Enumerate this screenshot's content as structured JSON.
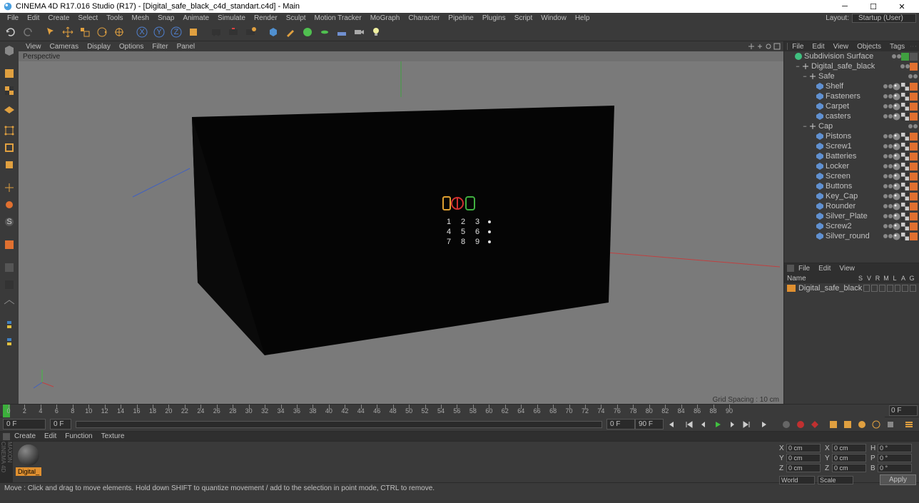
{
  "window": {
    "title": "CINEMA 4D R17.016 Studio (R17) - [Digital_safe_black_c4d_standart.c4d] - Main"
  },
  "menubar": {
    "items": [
      "File",
      "Edit",
      "Create",
      "Select",
      "Tools",
      "Mesh",
      "Snap",
      "Animate",
      "Simulate",
      "Render",
      "Sculpt",
      "Motion Tracker",
      "MoGraph",
      "Character",
      "Pipeline",
      "Plugins",
      "Script",
      "Window",
      "Help"
    ],
    "layout_label": "Layout:",
    "layout_value": "Startup (User)"
  },
  "viewport": {
    "menu": [
      "View",
      "Cameras",
      "Display",
      "Options",
      "Filter",
      "Panel"
    ],
    "label": "Perspective",
    "grid": "Grid Spacing : 10 cm"
  },
  "object_panel": {
    "tabs": [
      "File",
      "Edit",
      "View",
      "Objects",
      "Tags"
    ],
    "tree": [
      {
        "depth": 0,
        "exp": "",
        "icon": "sds",
        "name": "Subdivision Surface",
        "tags": [
          "green",
          "blank"
        ]
      },
      {
        "depth": 1,
        "exp": "−",
        "icon": "null",
        "name": "Digital_safe_black",
        "tags": [
          "sel"
        ]
      },
      {
        "depth": 2,
        "exp": "−",
        "icon": "null",
        "name": "Safe",
        "tags": []
      },
      {
        "depth": 3,
        "exp": "",
        "icon": "poly",
        "name": "Shelf",
        "tags": [
          "phong",
          "tex",
          "sel"
        ]
      },
      {
        "depth": 3,
        "exp": "",
        "icon": "poly",
        "name": "Fasteners",
        "tags": [
          "phong",
          "tex",
          "sel"
        ]
      },
      {
        "depth": 3,
        "exp": "",
        "icon": "poly",
        "name": "Carpet",
        "tags": [
          "phong",
          "tex",
          "sel"
        ]
      },
      {
        "depth": 3,
        "exp": "",
        "icon": "poly",
        "name": "casters",
        "tags": [
          "phong",
          "tex",
          "sel"
        ]
      },
      {
        "depth": 2,
        "exp": "−",
        "icon": "null",
        "name": "Cap",
        "tags": []
      },
      {
        "depth": 3,
        "exp": "",
        "icon": "poly",
        "name": "Pistons",
        "tags": [
          "phong",
          "tex",
          "sel"
        ]
      },
      {
        "depth": 3,
        "exp": "",
        "icon": "poly",
        "name": "Screw1",
        "tags": [
          "phong",
          "tex",
          "sel"
        ]
      },
      {
        "depth": 3,
        "exp": "",
        "icon": "poly",
        "name": "Batteries",
        "tags": [
          "phong",
          "tex",
          "sel"
        ]
      },
      {
        "depth": 3,
        "exp": "",
        "icon": "poly",
        "name": "Locker",
        "tags": [
          "phong",
          "tex",
          "sel"
        ]
      },
      {
        "depth": 3,
        "exp": "",
        "icon": "poly",
        "name": "Screen",
        "tags": [
          "phong",
          "tex",
          "sel"
        ]
      },
      {
        "depth": 3,
        "exp": "",
        "icon": "poly",
        "name": "Buttons",
        "tags": [
          "phong",
          "tex",
          "sel"
        ]
      },
      {
        "depth": 3,
        "exp": "",
        "icon": "poly",
        "name": "Key_Cap",
        "tags": [
          "phong",
          "tex",
          "sel"
        ]
      },
      {
        "depth": 3,
        "exp": "",
        "icon": "poly",
        "name": "Rounder",
        "tags": [
          "phong",
          "tex",
          "sel"
        ]
      },
      {
        "depth": 3,
        "exp": "",
        "icon": "poly",
        "name": "Silver_Plate",
        "tags": [
          "phong",
          "tex",
          "sel"
        ]
      },
      {
        "depth": 3,
        "exp": "",
        "icon": "poly",
        "name": "Screw2",
        "tags": [
          "phong",
          "tex",
          "sel"
        ]
      },
      {
        "depth": 3,
        "exp": "",
        "icon": "poly",
        "name": "Silver_round",
        "tags": [
          "phong",
          "tex",
          "sel"
        ]
      }
    ]
  },
  "attr_panel": {
    "tabs": [
      "File",
      "Edit",
      "View"
    ],
    "header": {
      "name": "Name",
      "cols": [
        "S",
        "V",
        "R",
        "M",
        "L",
        "A",
        "G"
      ]
    },
    "row": {
      "name": "Digital_safe_black"
    }
  },
  "timeline": {
    "start": 0,
    "end": 90,
    "step": 2,
    "start_field": "0 F",
    "end_field": "90 F",
    "field_left": "0 F",
    "field_slider_start": "0 F",
    "ruler_end_label": "0 F"
  },
  "func_menu": {
    "items": [
      "Create",
      "Edit",
      "Function",
      "Texture"
    ]
  },
  "material": {
    "label": "Digital_"
  },
  "coords": {
    "rows": [
      {
        "a": "X",
        "av": "0 cm",
        "b": "X",
        "bv": "0 cm",
        "c": "H",
        "cv": "0 °"
      },
      {
        "a": "Y",
        "av": "0 cm",
        "b": "Y",
        "bv": "0 cm",
        "c": "P",
        "cv": "0 °"
      },
      {
        "a": "Z",
        "av": "0 cm",
        "b": "Z",
        "bv": "0 cm",
        "c": "B",
        "cv": "0 °"
      }
    ],
    "sel1": "World",
    "sel2": "Scale",
    "apply": "Apply"
  },
  "status": "Move : Click and drag to move elements. Hold down SHIFT to quantize movement / add to the selection in point mode, CTRL to remove.",
  "maxon": "MAXON CINEMA 4D"
}
